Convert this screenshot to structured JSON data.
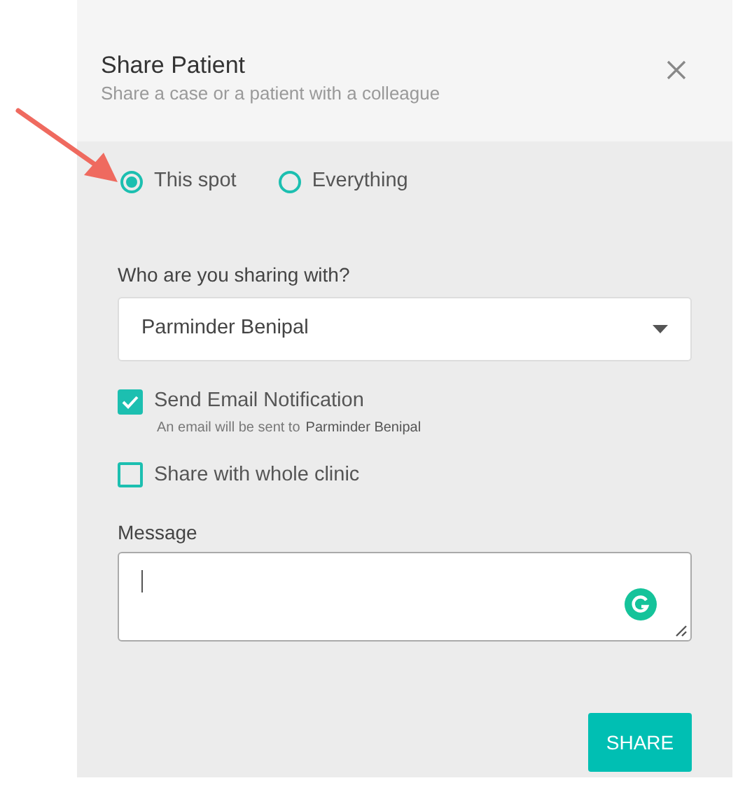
{
  "dialog": {
    "title": "Share Patient",
    "subtitle": "Share a case or a patient with a colleague"
  },
  "scope_options": [
    {
      "label": "This spot",
      "selected": true
    },
    {
      "label": "Everything",
      "selected": false
    }
  ],
  "recipient": {
    "label": "Who are you sharing with?",
    "value": "Parminder Benipal"
  },
  "options": [
    {
      "label": "Send Email Notification",
      "checked": true,
      "note": "An email will be sent to",
      "note_name": "Parminder Benipal"
    },
    {
      "label": "Share with whole clinic",
      "checked": false
    }
  ],
  "message": {
    "label": "Message"
  },
  "buttons": [
    "SHARE"
  ]
}
